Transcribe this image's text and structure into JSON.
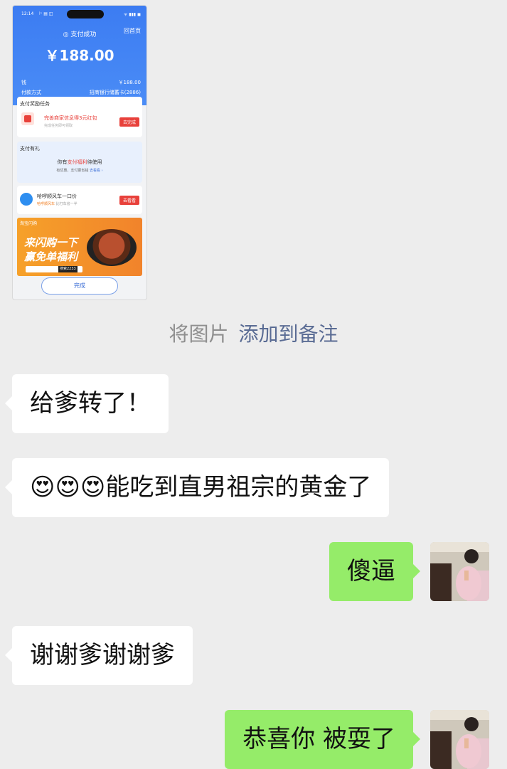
{
  "image_card": {
    "status_time": "12:14",
    "status_icons": "⚐ ▤ ◫",
    "status_signal": "ᯤ ▮▮▮ ◼",
    "success_label": "支付成功",
    "home_label": "回首页",
    "amount": "￥188.00",
    "item_label": "钱",
    "item_value": "￥188.00",
    "payment_method_label": "付款方式",
    "payment_method_value": "招商银行储蓄卡(2886)",
    "task_section_title": "支付奖励任务",
    "task_title": "完善商家信息得3元红包",
    "task_sub": "完成任务即可领取",
    "task_button": "去完成",
    "gift_section_title": "支付有礼",
    "gift_line_prefix": "你有",
    "gift_highlight": "支付福利",
    "gift_line_suffix": "待使用",
    "gift_sub": "有优惠，支付更省钱",
    "gift_link": "去看看 ›",
    "promo_title": "哈啰顺风车一口价",
    "promo_sub_brand": "哈啰顺风车",
    "promo_sub": "比打车省一半",
    "promo_button": "去看看",
    "banner_tag": "淘宝闪购",
    "banner_line1": "来闪购一下",
    "banner_line2": "赢免单福利",
    "banner_search": "",
    "banner_code": "搜索2233",
    "done_button": "完成"
  },
  "system_tip": {
    "prefix": "将图片",
    "link": "添加到备注"
  },
  "messages": [
    {
      "side": "left",
      "text": "给爹转了！"
    },
    {
      "side": "left",
      "text": "😍😍😍能吃到直男祖宗的黄金了"
    },
    {
      "side": "right",
      "text": "傻逼"
    },
    {
      "side": "left",
      "text": "谢谢爹谢谢爹"
    },
    {
      "side": "right",
      "text": "恭喜你 被耍了"
    }
  ],
  "colors": {
    "chat_background": "#ededed",
    "outgoing_bubble": "#95ec69",
    "incoming_bubble": "#ffffff",
    "link": "#5a6c94",
    "alipay_blue": "#3c7cf2"
  }
}
